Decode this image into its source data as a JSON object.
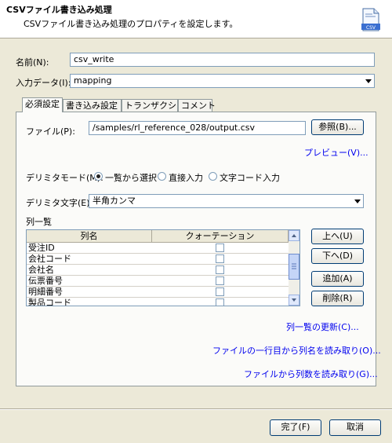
{
  "header": {
    "title": "CSVファイル書き込み処理",
    "subtitle": "CSVファイル書き込み処理のプロパティを設定します。",
    "icon_label": "CSV"
  },
  "form": {
    "name_label": "名前(N):",
    "name_value": "csv_write",
    "input_label": "入力データ(I):",
    "input_value": "mapping"
  },
  "tabs": [
    {
      "label": "必須設定"
    },
    {
      "label": "書き込み設定"
    },
    {
      "label": "トランザクション"
    },
    {
      "label": "コメント"
    }
  ],
  "required": {
    "file_label": "ファイル(P):",
    "file_value": "/samples/rl_reference_028/output.csv",
    "browse_button": "参照(B)...",
    "preview_link": "プレビュー(V)...",
    "delimiter_mode_label": "デリミタモード(M):",
    "delimiter_modes": [
      "一覧から選択",
      "直接入力",
      "文字コード入力"
    ],
    "delimiter_label": "デリミタ文字(E):",
    "delimiter_value": "半角カンマ",
    "column_list_label": "列一覧"
  },
  "table": {
    "headers": [
      "列名",
      "クォーテーション"
    ],
    "rows": [
      {
        "name": "受注ID"
      },
      {
        "name": "会社コード"
      },
      {
        "name": "会社名"
      },
      {
        "name": "伝票番号"
      },
      {
        "name": "明細番号"
      },
      {
        "name": "製品コード"
      }
    ]
  },
  "side_buttons": {
    "up": "上へ(U)",
    "down": "下へ(D)",
    "add": "追加(A)",
    "delete": "削除(R)"
  },
  "links": {
    "refresh": "列一覧の更新(C)...",
    "read_header": "ファイルの一行目から列名を読み取り(O)...",
    "read_count": "ファイルから列数を読み取り(G)..."
  },
  "footer": {
    "ok": "完了(F)",
    "cancel": "取消"
  },
  "colors": {
    "dialog_bg": "#ece9d8",
    "link": "#0000ee",
    "border": "#7f9db9"
  }
}
